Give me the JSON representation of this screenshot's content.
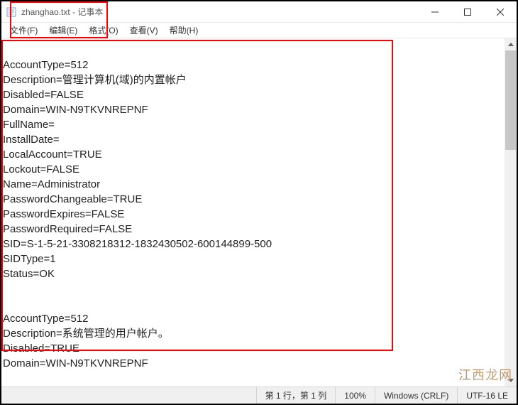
{
  "title": "zhanghao.txt - 记事本",
  "menu": {
    "file": "文件(F)",
    "edit": "编辑(E)",
    "format": "格式(O)",
    "view": "查看(V)",
    "help": "帮助(H)"
  },
  "content": "\nAccountType=512\nDescription=管理计算机(域)的内置帐户\nDisabled=FALSE\nDomain=WIN-N9TKVNREPNF\nFullName=\nInstallDate=\nLocalAccount=TRUE\nLockout=FALSE\nName=Administrator\nPasswordChangeable=TRUE\nPasswordExpires=FALSE\nPasswordRequired=FALSE\nSID=S-1-5-21-3308218312-1832430502-600144899-500\nSIDType=1\nStatus=OK\n\n\nAccountType=512\nDescription=系统管理的用户帐户。\nDisabled=TRUE\nDomain=WIN-N9TKVNREPNF",
  "statusbar": {
    "position": "第 1 行，第 1 列",
    "zoom": "100%",
    "line_ending": "Windows (CRLF)",
    "encoding": "UTF-16 LE"
  },
  "watermark": "江西龙网"
}
